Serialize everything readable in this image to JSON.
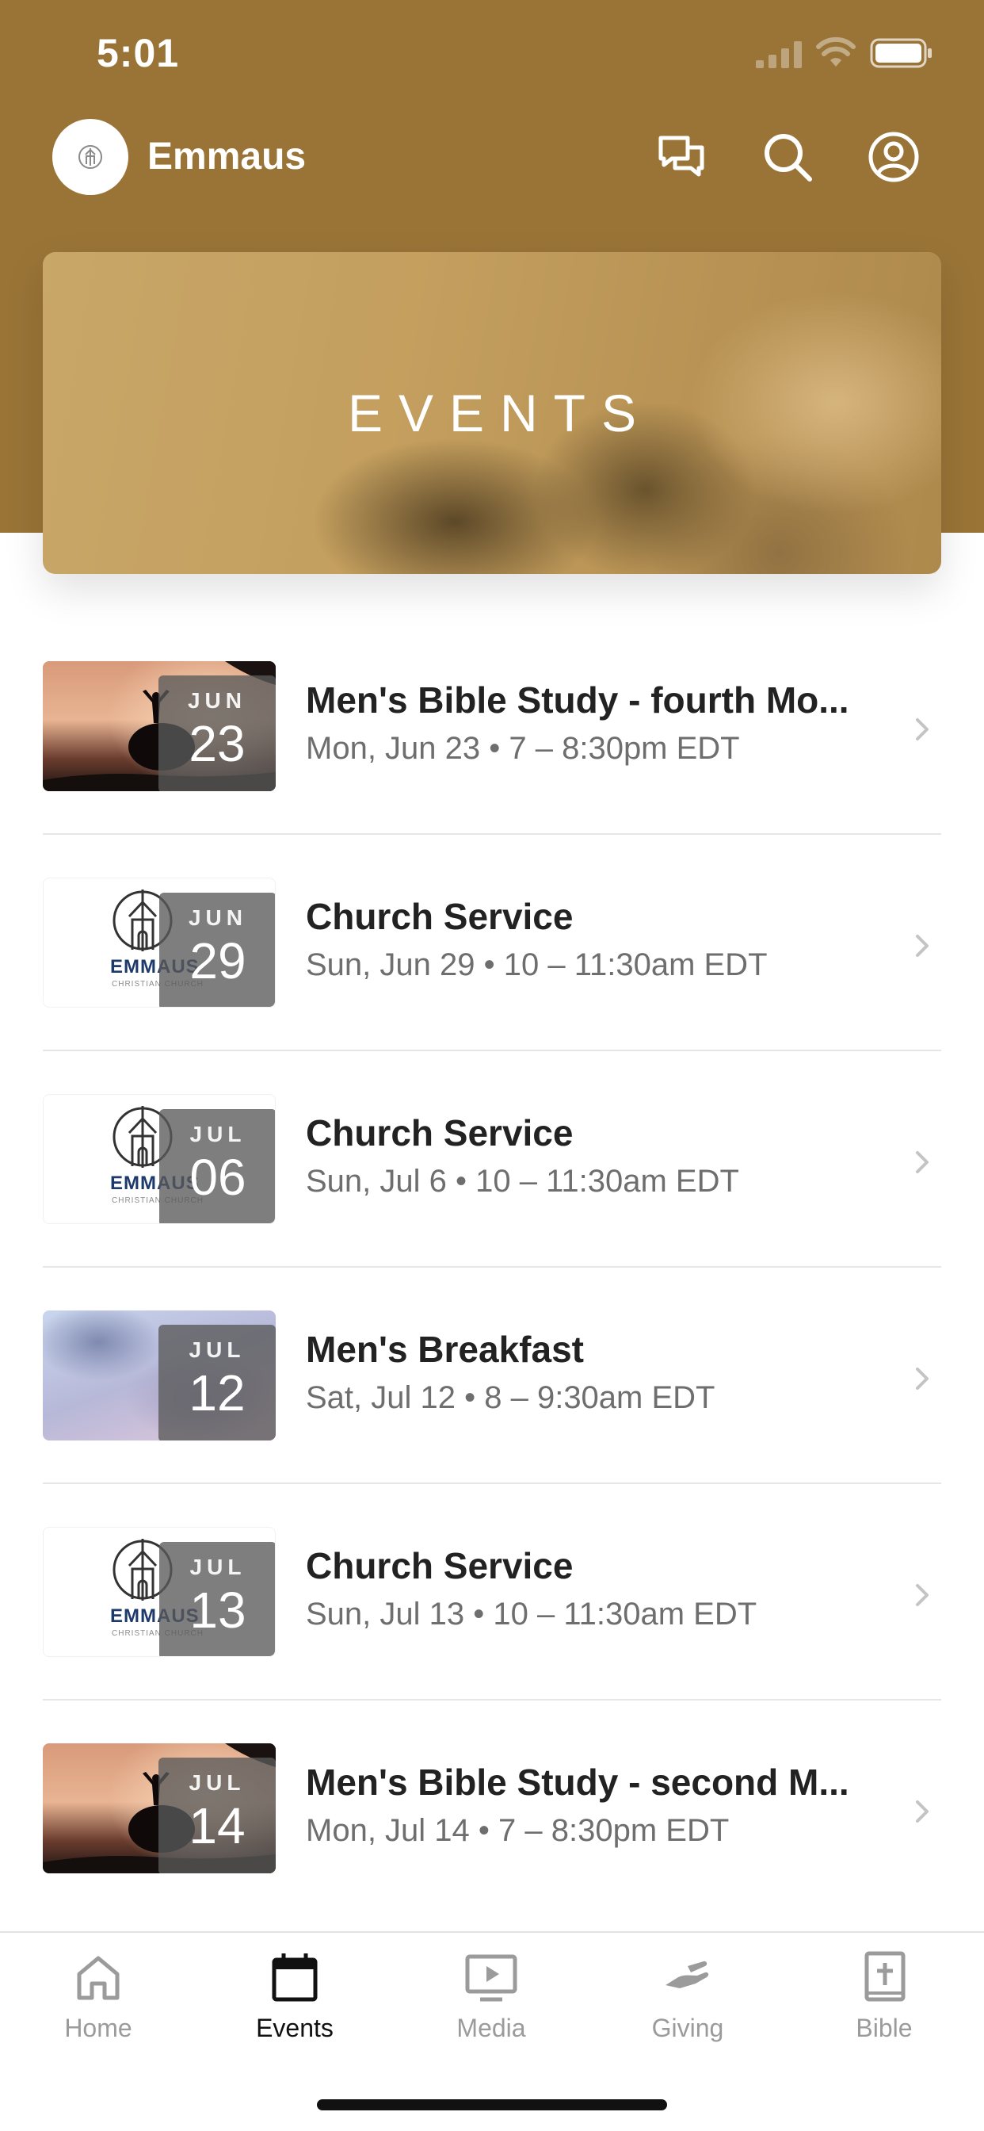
{
  "status_bar": {
    "time": "5:01"
  },
  "header": {
    "org_name": "Emmaus"
  },
  "banner": {
    "title": "EVENTS"
  },
  "events": [
    {
      "thumb": "sunset",
      "month": "JUN",
      "day": "23",
      "title": "Men's Bible Study - fourth Mo...",
      "meta": "Mon, Jun 23 • 7 – 8:30pm EDT"
    },
    {
      "thumb": "logo",
      "month": "JUN",
      "day": "29",
      "title": "Church Service",
      "meta": "Sun, Jun 29 • 10 – 11:30am EDT"
    },
    {
      "thumb": "logo",
      "month": "JUL",
      "day": "06",
      "title": "Church Service",
      "meta": "Sun, Jul 6 • 10 – 11:30am EDT"
    },
    {
      "thumb": "sky",
      "month": "JUL",
      "day": "12",
      "title": "Men's Breakfast",
      "meta": "Sat, Jul 12 • 8 – 9:30am EDT"
    },
    {
      "thumb": "logo",
      "month": "JUL",
      "day": "13",
      "title": "Church Service",
      "meta": "Sun, Jul 13 • 10 – 11:30am EDT"
    },
    {
      "thumb": "sunset",
      "month": "JUL",
      "day": "14",
      "title": "Men's Bible Study - second M...",
      "meta": "Mon, Jul 14 • 7 – 8:30pm EDT"
    }
  ],
  "logo_thumb": {
    "name": "EMMAUS",
    "tagline": "CHRISTIAN CHURCH"
  },
  "tabs": [
    {
      "label": "Home",
      "icon": "home-icon",
      "active": false
    },
    {
      "label": "Events",
      "icon": "calendar-icon",
      "active": true
    },
    {
      "label": "Media",
      "icon": "media-icon",
      "active": false
    },
    {
      "label": "Giving",
      "icon": "giving-icon",
      "active": false
    },
    {
      "label": "Bible",
      "icon": "bible-icon",
      "active": false
    }
  ],
  "colors": {
    "header_brand": "#9a7437",
    "text_primary": "#222222",
    "text_secondary": "#6e6e6e",
    "tab_inactive": "#9b9b9b",
    "tab_active": "#111111"
  }
}
